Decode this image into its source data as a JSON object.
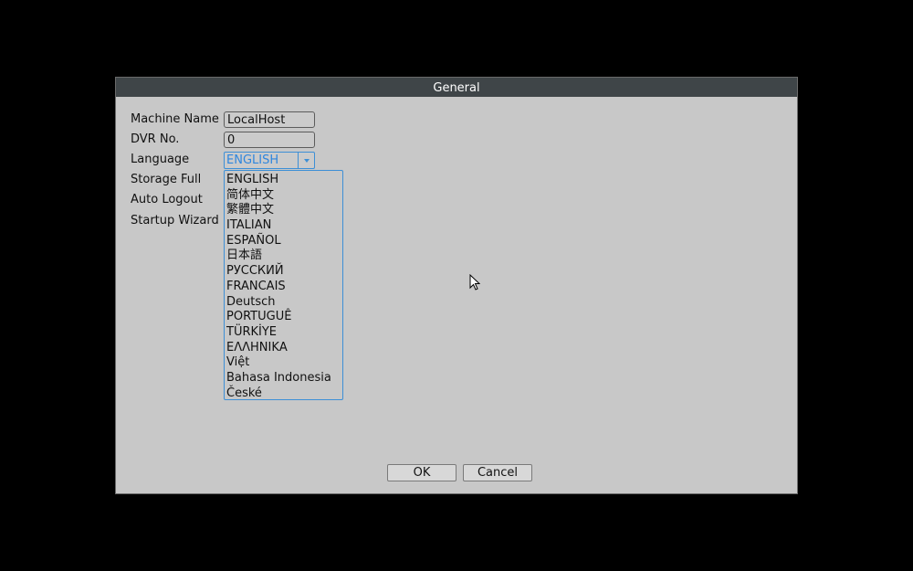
{
  "dialog": {
    "title": "General",
    "ok_label": "OK",
    "cancel_label": "Cancel"
  },
  "form": {
    "machine_name_label": "Machine Name",
    "machine_name_value": "LocalHost",
    "dvr_no_label": "DVR No.",
    "dvr_no_value": "0",
    "language_label": "Language",
    "language_value": "ENGLISH",
    "storage_full_label": "Storage Full",
    "auto_logout_label": "Auto Logout",
    "startup_wizard_label": "Startup Wizard"
  },
  "language_options": [
    "ENGLISH",
    "简体中文",
    "繁體中文",
    "ITALIAN",
    "ESPAÑOL",
    "日本語",
    "РУССКИЙ",
    "FRANCAIS",
    "Deutsch",
    "PORTUGUÊ",
    "TÜRKİYE",
    "ΕΛΛΗΝΙΚΑ",
    "Việt",
    "Bahasa Indonesia",
    "České"
  ],
  "colors": {
    "titlebar": "#3f4548",
    "dialog_bg": "#c8c8c8",
    "accent_blue": "#3d8fd6"
  },
  "icons": {
    "dropdown_arrow": "chevron-down-icon",
    "pointer": "mouse-cursor-icon"
  }
}
